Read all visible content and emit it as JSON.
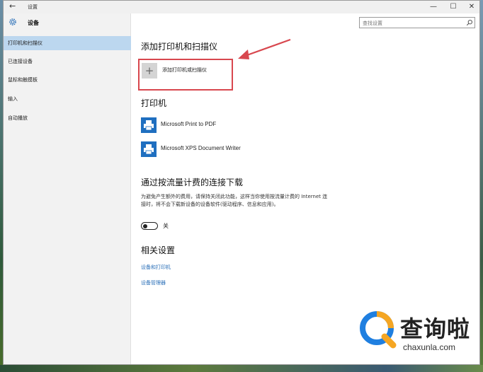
{
  "window": {
    "title": "设置",
    "controls": {
      "minimize": "—",
      "maximize": "☐",
      "close": "✕"
    }
  },
  "sidebar": {
    "heading": "设备",
    "items": [
      {
        "label": "打印机和扫描仪",
        "active": true
      },
      {
        "label": "已连接设备",
        "active": false
      },
      {
        "label": "鼠标和触摸板",
        "active": false
      },
      {
        "label": "输入",
        "active": false
      },
      {
        "label": "自动播放",
        "active": false
      }
    ]
  },
  "search": {
    "placeholder": "查找设置"
  },
  "main": {
    "add_section": {
      "heading": "添加打印机和扫描仪",
      "button_symbol": "+",
      "button_label": "添加打印机或扫描仪"
    },
    "printers": {
      "heading": "打印机",
      "items": [
        {
          "name": "Microsoft Print to PDF"
        },
        {
          "name": "Microsoft XPS Document Writer"
        }
      ]
    },
    "metered": {
      "heading": "通过按流量计费的连接下载",
      "description": "为避免产生额外的费用，请保持关闭此功能，这样当你使用按流量计费的 Internet 连接时，将不会下载新设备的设备软件(驱动程序、信息和应用)。",
      "toggle_label": "关",
      "toggle_on": false
    },
    "related": {
      "heading": "相关设置",
      "links": [
        "设备和打印机",
        "设备管理器"
      ]
    }
  },
  "watermark": {
    "chinese": "查询啦",
    "url": "chaxunla.com"
  },
  "colors": {
    "accent": "#2a6fb8",
    "sidebar_active": "#bcd7ef",
    "annotation_red": "#d8474e"
  }
}
